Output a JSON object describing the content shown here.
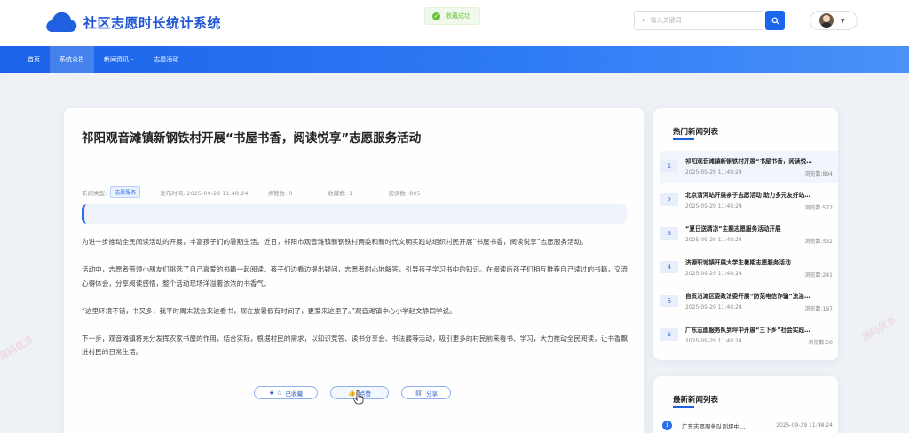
{
  "app": {
    "title": "社区志愿时长统计系统",
    "watermark": "源码优多"
  },
  "toast": {
    "text": "收藏成功"
  },
  "search": {
    "placeholder": "输入关键词"
  },
  "nav": {
    "items": [
      {
        "label": "首页"
      },
      {
        "label": "系统公告"
      },
      {
        "label": "新闻资讯"
      },
      {
        "label": "志愿活动"
      }
    ]
  },
  "article": {
    "title": "祁阳观音滩镇新钢铁村开展“书屋书香，阅读悦享”志愿服务活动",
    "meta": {
      "type_label": "新闻类型:",
      "type_value": "志愿服务",
      "publish": "发布时间: 2025-09-29 11:48:24",
      "likes": "点赞数: 0",
      "favorites": "收藏数: 1",
      "reads": "阅读数: 895"
    },
    "paragraphs": [
      "为进一步推动全民阅读活动的开展，丰富孩子们的暑期生活。近日，祁阳市观音滩镇新钢铁村两委和新时代文明实践站组织村民开展“书屋书香，阅读悦享”志愿服务活动。",
      "活动中，志愿者带领小朋友们挑选了自己喜爱的书籍一起阅读。孩子们边看边提出疑问，志愿者耐心地解答，引导孩子学习书中的知识。在阅读后孩子们相互推荐自己读过的书籍，交流心得体会，分享阅读感悟，整个活动现场洋溢着浓浓的书香气。",
      "“这里环境不错，书又多，我平时周末就会来这看书，现在放暑假有时间了，更爱来这里了。”观音滩镇中心小学赵文静同学说。",
      "下一步，观音滩镇将充分发挥农家书屋的作用，结合实际，根据村民的需求，以知识竞答、读书分享会、书法展等活动，吸引更多的村民前来看书、学习，大力推动全民阅读，让书香飘进村民的日常生活。"
    ],
    "actions": {
      "favorite": "已收藏",
      "like": "点赞",
      "share": "分享"
    }
  },
  "hot_news": {
    "heading": "热门新闻列表",
    "items": [
      {
        "rank": "1",
        "title": "祁阳观音滩镇新钢铁村开展“书屋书香，阅读悦…",
        "date": "2025-09-29 11:48:24",
        "views": "浏览数:894"
      },
      {
        "rank": "2",
        "title": "北京清河站开展亲子志愿活动 助力多元友好站…",
        "date": "2025-09-29 11:48:24",
        "views": "浏览数:572"
      },
      {
        "rank": "3",
        "title": "“夏日送清凉”主题志愿服务活动开展",
        "date": "2025-09-29 11:48:24",
        "views": "浏览数:532"
      },
      {
        "rank": "4",
        "title": "济源职城镇开展大学生暑期志愿服务活动",
        "date": "2025-09-29 11:48:24",
        "views": "浏览数:241"
      },
      {
        "rank": "5",
        "title": "自贡沿滩区委政法委开展“防范电信诈骗”法治…",
        "date": "2025-09-29 11:48:24",
        "views": "浏览数:197"
      },
      {
        "rank": "6",
        "title": "广东志愿服务队到坪中开展“三下乡”社会实践…",
        "date": "2025-09-29 11:48:24",
        "views": "浏览数:50"
      }
    ]
  },
  "latest_news": {
    "heading": "最新新闻列表",
    "items": [
      {
        "num": "1",
        "title": "广东志愿服务队到坪中…",
        "date": "2025-09-29 11:48:24"
      }
    ]
  },
  "colors": {
    "primary": "#1a66ee",
    "nav_gradient_start": "#1b63e8",
    "success": "#67c23a"
  }
}
